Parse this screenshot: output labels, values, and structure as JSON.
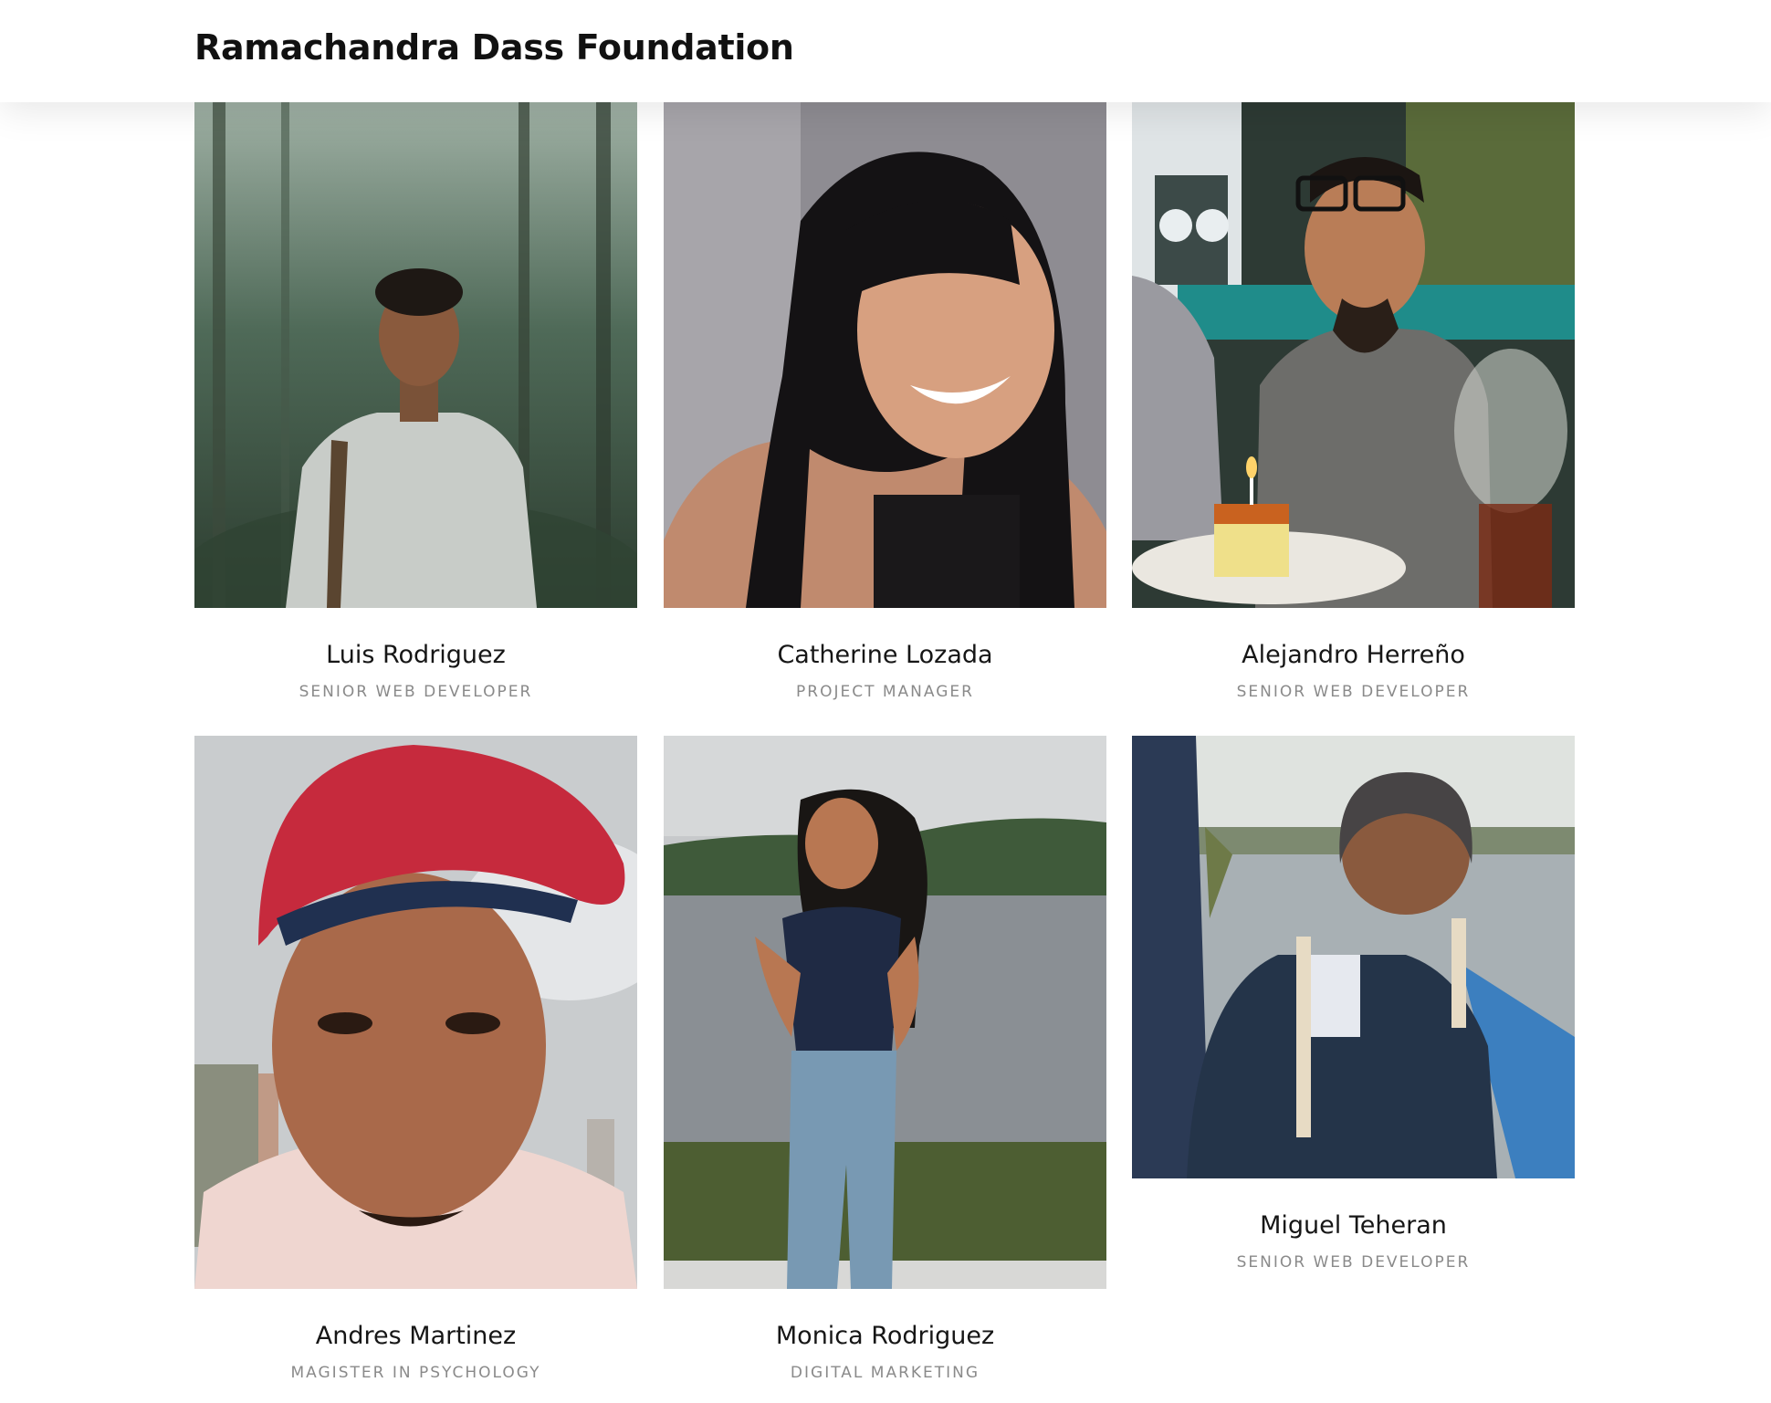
{
  "site": {
    "title": "Ramachandra Dass Foundation"
  },
  "team": [
    {
      "name": "Luis Rodriguez",
      "role": "SENIOR WEB DEVELOPER"
    },
    {
      "name": "Catherine Lozada",
      "role": "PROJECT MANAGER"
    },
    {
      "name": "Alejandro Herreño",
      "role": "SENIOR WEB DEVELOPER"
    },
    {
      "name": "Andres Martinez",
      "role": "MAGISTER IN PSYCHOLOGY"
    },
    {
      "name": "Monica Rodriguez",
      "role": "DIGITAL MARKETING"
    },
    {
      "name": "Miguel Teheran",
      "role": "SENIOR WEB DEVELOPER"
    }
  ]
}
